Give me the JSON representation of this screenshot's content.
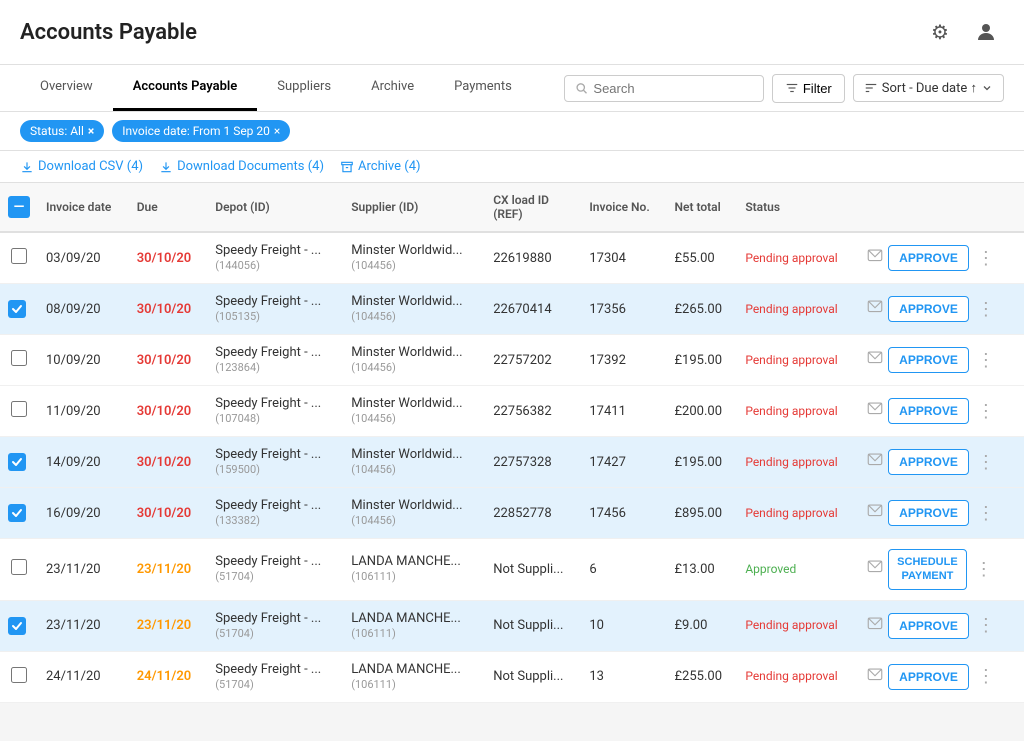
{
  "header": {
    "title": "Accounts Payable",
    "gear_icon": "⚙",
    "user_icon": "👤"
  },
  "nav": {
    "tabs": [
      {
        "id": "overview",
        "label": "Overview",
        "active": false
      },
      {
        "id": "accounts-payable",
        "label": "Accounts Payable",
        "active": true
      },
      {
        "id": "suppliers",
        "label": "Suppliers",
        "active": false
      },
      {
        "id": "archive",
        "label": "Archive",
        "active": false
      },
      {
        "id": "payments",
        "label": "Payments",
        "active": false
      }
    ],
    "search_placeholder": "Search",
    "filter_label": "Filter",
    "sort_label": "Sort - Due date ↑"
  },
  "filters": {
    "status_chip": "Status: All ×",
    "date_chip": "Invoice date: From 1 Sep 20 ×"
  },
  "actions": {
    "download_csv": "Download CSV (4)",
    "download_docs": "Download Documents (4)",
    "archive": "Archive (4)"
  },
  "table": {
    "columns": [
      "Invoice date",
      "Due",
      "Depot (ID)",
      "Supplier (ID)",
      "CX load ID (REF)",
      "Invoice No.",
      "Net total",
      "Status",
      ""
    ],
    "rows": [
      {
        "selected": false,
        "invoice_date": "03/09/20",
        "due": "30/10/20",
        "due_color": "red",
        "depot": "Speedy Freight - ...",
        "depot_id": "(144056)",
        "supplier": "Minster Worldwid...",
        "supplier_id": "(104456)",
        "cx_load": "22619880",
        "invoice_no": "17304",
        "net_total": "£55.00",
        "status": "Pending approval",
        "status_color": "pending",
        "action": "APPROVE"
      },
      {
        "selected": true,
        "invoice_date": "08/09/20",
        "due": "30/10/20",
        "due_color": "red",
        "depot": "Speedy Freight - ...",
        "depot_id": "(105135)",
        "supplier": "Minster Worldwid...",
        "supplier_id": "(104456)",
        "cx_load": "22670414",
        "invoice_no": "17356",
        "net_total": "£265.00",
        "status": "Pending approval",
        "status_color": "pending",
        "action": "APPROVE"
      },
      {
        "selected": false,
        "invoice_date": "10/09/20",
        "due": "30/10/20",
        "due_color": "red",
        "depot": "Speedy Freight - ...",
        "depot_id": "(123864)",
        "supplier": "Minster Worldwid...",
        "supplier_id": "(104456)",
        "cx_load": "22757202",
        "invoice_no": "17392",
        "net_total": "£195.00",
        "status": "Pending approval",
        "status_color": "pending",
        "action": "APPROVE"
      },
      {
        "selected": false,
        "invoice_date": "11/09/20",
        "due": "30/10/20",
        "due_color": "red",
        "depot": "Speedy Freight - ...",
        "depot_id": "(107048)",
        "supplier": "Minster Worldwid...",
        "supplier_id": "(104456)",
        "cx_load": "22756382",
        "invoice_no": "17411",
        "net_total": "£200.00",
        "status": "Pending approval",
        "status_color": "pending",
        "action": "APPROVE"
      },
      {
        "selected": true,
        "invoice_date": "14/09/20",
        "due": "30/10/20",
        "due_color": "red",
        "depot": "Speedy Freight - ...",
        "depot_id": "(159500)",
        "supplier": "Minster Worldwid...",
        "supplier_id": "(104456)",
        "cx_load": "22757328",
        "invoice_no": "17427",
        "net_total": "£195.00",
        "status": "Pending approval",
        "status_color": "pending",
        "action": "APPROVE"
      },
      {
        "selected": true,
        "invoice_date": "16/09/20",
        "due": "30/10/20",
        "due_color": "red",
        "depot": "Speedy Freight - ...",
        "depot_id": "(133382)",
        "supplier": "Minster Worldwid...",
        "supplier_id": "(104456)",
        "cx_load": "22852778",
        "invoice_no": "17456",
        "net_total": "£895.00",
        "status": "Pending approval",
        "status_color": "pending",
        "action": "APPROVE"
      },
      {
        "selected": false,
        "invoice_date": "23/11/20",
        "due": "23/11/20",
        "due_color": "orange",
        "depot": "Speedy Freight - ...",
        "depot_id": "(51704)",
        "supplier": "LANDA MANCHE...",
        "supplier_id": "(106111)",
        "cx_load": "Not Suppli...",
        "invoice_no": "6",
        "net_total": "£13.00",
        "status": "Approved",
        "status_color": "approved",
        "action": "SCHEDULE PAYMENT"
      },
      {
        "selected": true,
        "invoice_date": "23/11/20",
        "due": "23/11/20",
        "due_color": "orange",
        "depot": "Speedy Freight - ...",
        "depot_id": "(51704)",
        "supplier": "LANDA MANCHE...",
        "supplier_id": "(106111)",
        "cx_load": "Not Suppli...",
        "invoice_no": "10",
        "net_total": "£9.00",
        "status": "Pending approval",
        "status_color": "pending",
        "action": "APPROVE"
      },
      {
        "selected": false,
        "invoice_date": "24/11/20",
        "due": "24/11/20",
        "due_color": "orange",
        "depot": "Speedy Freight - ...",
        "depot_id": "(51704)",
        "supplier": "LANDA MANCHE...",
        "supplier_id": "(106111)",
        "cx_load": "Not Suppli...",
        "invoice_no": "13",
        "net_total": "£255.00",
        "status": "Pending approval",
        "status_color": "pending",
        "action": "APPROVE"
      }
    ]
  }
}
